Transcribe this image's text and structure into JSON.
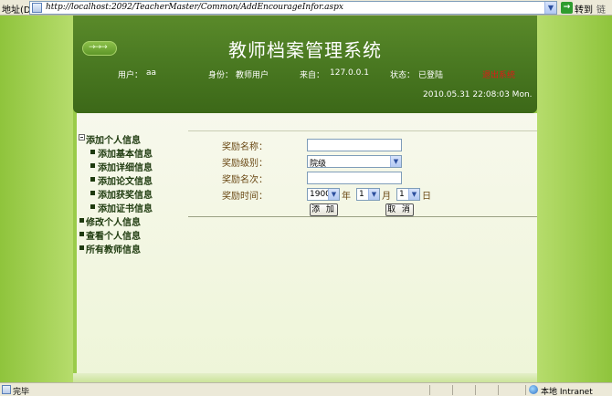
{
  "browser": {
    "address_label": "地址(D)",
    "url": "http://localhost:2092/TeacherMaster/Common/AddEncourageInfor.aspx",
    "go_label": "转到",
    "links_label": "链接",
    "status_text": "完毕",
    "zone_text": "本地 Intranet"
  },
  "header": {
    "title": "教师档案管理系统",
    "user_label": "用户：",
    "user_value": "aa",
    "role_label": "身份：",
    "role_value": "教师用户",
    "from_label": "来自：",
    "from_value": "127.0.0.1",
    "state_label": "状态：",
    "state_value": "已登陆",
    "logout_label": "退出系统",
    "datetime": "2010.05.31  22:08:03  Mon."
  },
  "menu": {
    "groups": [
      {
        "label": "添加个人信息",
        "expanded": true,
        "items": [
          "添加基本信息",
          "添加详细信息",
          "添加论文信息",
          "添加获奖信息",
          "添加证书信息"
        ]
      },
      {
        "label": "修改个人信息"
      },
      {
        "label": "查看个人信息"
      },
      {
        "label": "所有教师信息"
      }
    ]
  },
  "form": {
    "name_label": "奖励名称：",
    "name_value": "",
    "level_label": "奖励级别：",
    "level_value": "院级",
    "rank_label": "奖励名次：",
    "rank_value": "",
    "time_label": "奖励时间：",
    "year_value": "1900",
    "year_unit": "年",
    "month_value": "1",
    "month_unit": "月",
    "day_value": "1",
    "day_unit": "日",
    "add_button": "添 加",
    "cancel_button": "取 消"
  },
  "colors": {
    "header_green": "#4b7a22",
    "page_green": "#9acb49",
    "logout_red": "#e01818",
    "label_brown": "#6b4a16"
  }
}
